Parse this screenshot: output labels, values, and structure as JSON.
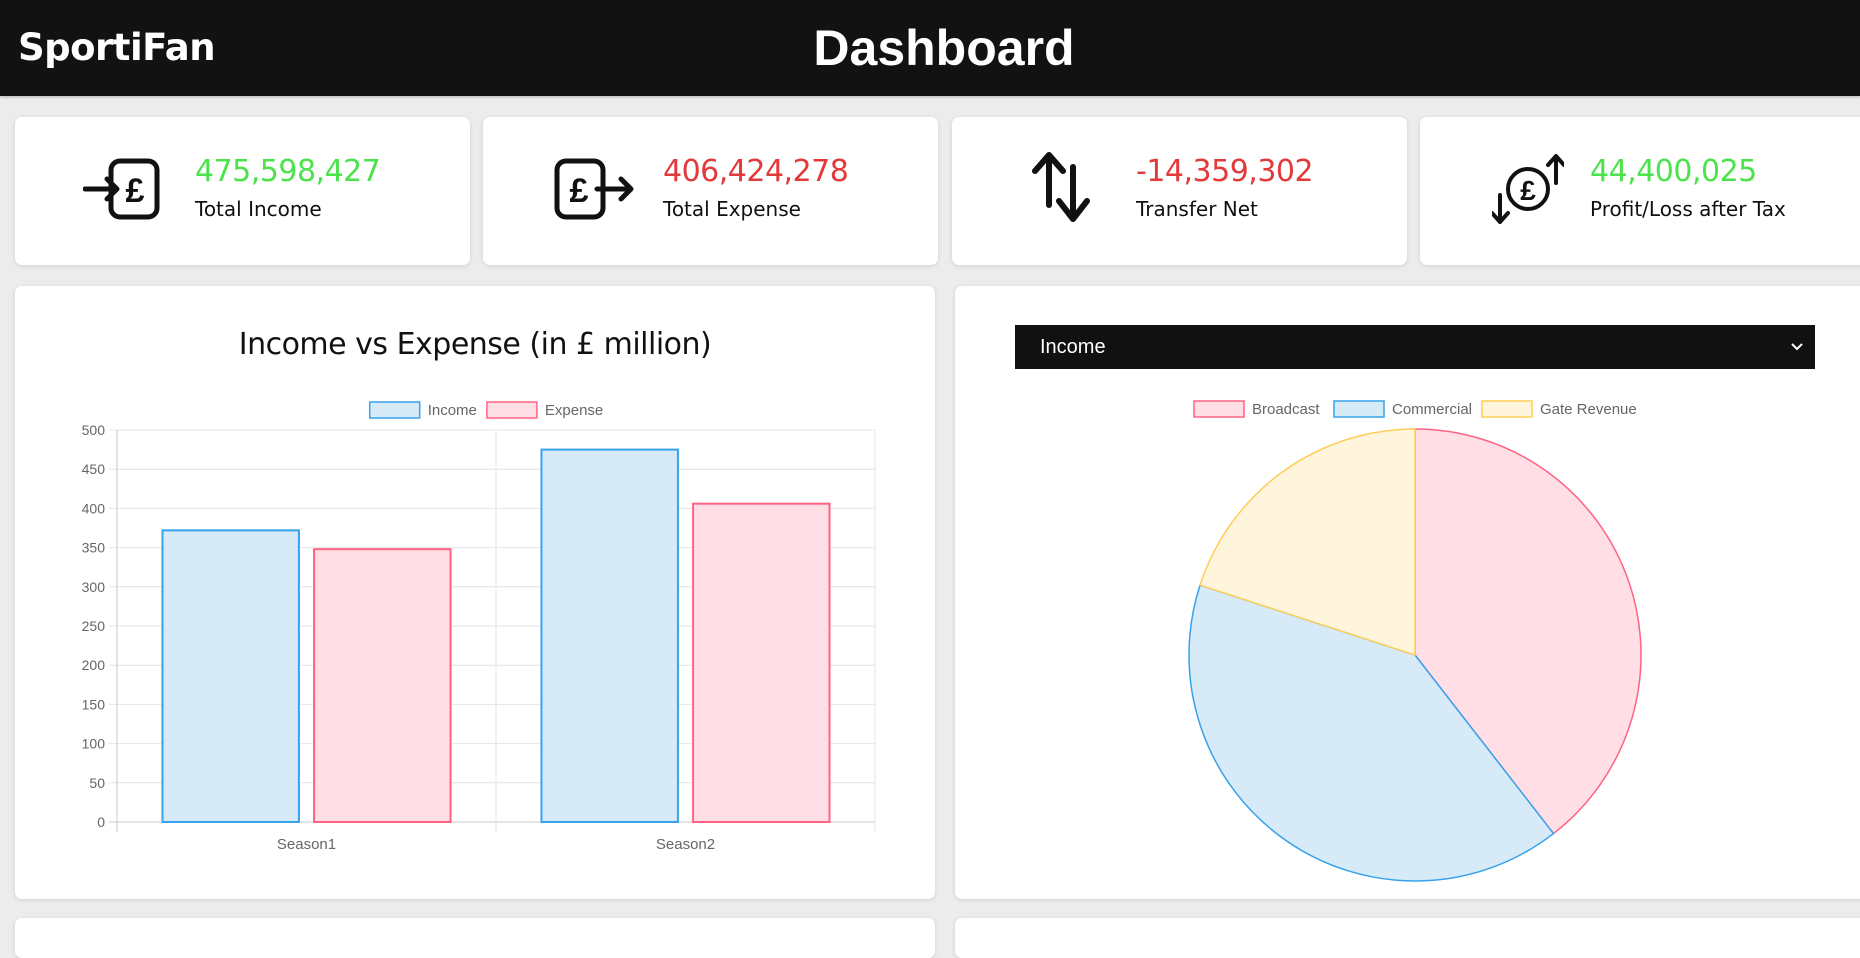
{
  "app": {
    "logo_text": "SportiFan",
    "page_title": "Dashboard"
  },
  "stats": [
    {
      "value": "475,598,427",
      "label": "Total Income",
      "value_color": "#4ce24c",
      "icon": "pound-in-icon"
    },
    {
      "value": "406,424,278",
      "label": "Total Expense",
      "value_color": "#e23a3a",
      "icon": "pound-out-icon"
    },
    {
      "value": "-14,359,302",
      "label": "Transfer Net",
      "value_color": "#e23a3a",
      "icon": "transfer-arrows-icon"
    },
    {
      "value": "44,400,025",
      "label": "Profit/Loss after Tax",
      "value_color": "#4ce24c",
      "icon": "pound-exchange-icon"
    }
  ],
  "income_expense": {
    "title": "Income vs Expense (in £ million)"
  },
  "breakdown": {
    "dropdown_value": "Income"
  },
  "colors": {
    "income_fill": "#d6eaf8",
    "income_stroke": "#36a2eb",
    "expense_fill": "#ffdfe5",
    "expense_stroke": "#ff6384",
    "gate_fill": "#fff4dc",
    "gate_stroke": "#ffce56"
  },
  "chart_data": [
    {
      "type": "bar",
      "title": "Income vs Expense (in £ million)",
      "categories": [
        "Season1",
        "Season2"
      ],
      "series": [
        {
          "name": "Income",
          "values": [
            372,
            475
          ]
        },
        {
          "name": "Expense",
          "values": [
            348,
            406
          ]
        }
      ],
      "ylim": [
        0,
        500
      ],
      "yticks": [
        0,
        50,
        100,
        150,
        200,
        250,
        300,
        350,
        400,
        450,
        500
      ],
      "legend": "top",
      "grid": true
    },
    {
      "type": "pie",
      "labels": [
        "Broadcast",
        "Commercial",
        "Gate Revenue"
      ],
      "values": [
        39.5,
        40.5,
        20.0
      ],
      "legend": "top"
    }
  ]
}
